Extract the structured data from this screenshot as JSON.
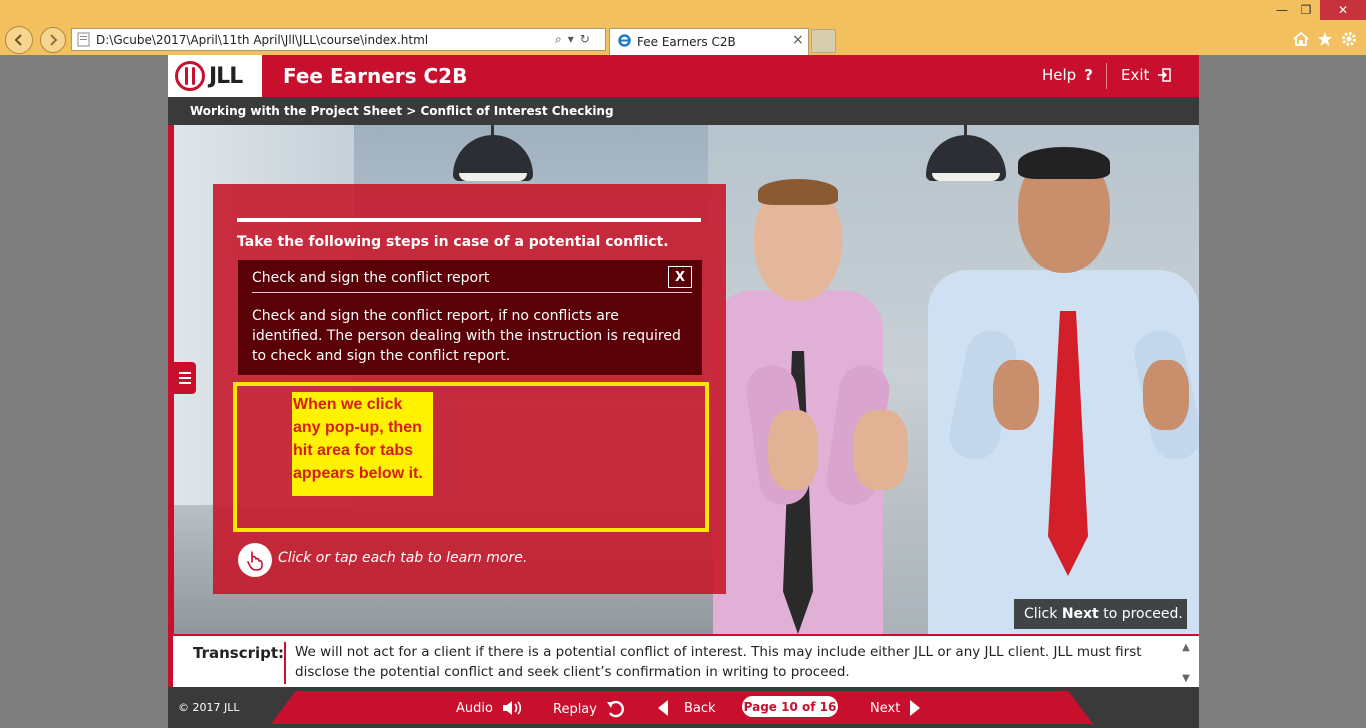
{
  "browser": {
    "address": "D:\\Gcube\\2017\\April\\11th April\\Jll\\JLL\\course\\index.html",
    "tab_title": "Fee Earners C2B",
    "tab_close": "×",
    "win_minimize": "—",
    "win_restore": "❐",
    "win_close": "✕"
  },
  "header": {
    "logo": "JLL",
    "title": "Fee Earners C2B",
    "help": "Help",
    "exit": "Exit"
  },
  "breadcrumb": "Working with the Project Sheet > Conflict of Interest Checking",
  "panel": {
    "heading": "Take the following steps in case of a potential conflict.",
    "popup_title": "Check and sign the conflict report",
    "popup_close": "X",
    "popup_body": "Check and sign the conflict report, if no conflicts are identified. The person dealing with the instruction is required to check and sign the conflict report.",
    "note": "When we click any pop-up, then hit area for tabs appears below it.",
    "instruction": "Click or tap each tab to learn more."
  },
  "proceed": {
    "pre": "Click ",
    "bold": "Next",
    "post": " to proceed."
  },
  "transcript": {
    "label": "Transcript:",
    "text": "We will not act for a client if there is a potential conflict of interest. This may include either JLL or any JLL client. JLL must first disclose the potential conflict and seek client’s confirmation in writing to proceed."
  },
  "footer": {
    "copyright": "© 2017 JLL",
    "audio": "Audio",
    "replay": "Replay",
    "back": "Back",
    "page": "Page 10 of 16",
    "next": "Next"
  },
  "colors": {
    "brand_red": "#c8102e",
    "note_yellow": "#fff200",
    "dark_bar": "#3a3a3a"
  }
}
